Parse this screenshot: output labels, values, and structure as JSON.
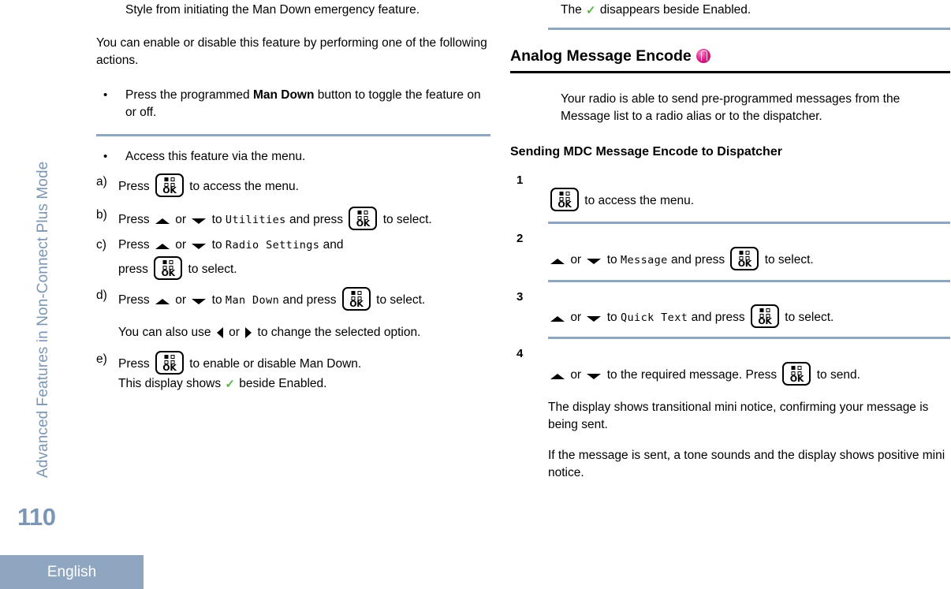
{
  "sidebar": {
    "running_head": "Advanced Features in Non-Connect Plus Mode",
    "page_number": "110",
    "language": "English",
    "accent_color": "#8fa6c0"
  },
  "icons": {
    "ok_button_label": "OK",
    "ok_button_name": "menu-ok-button-icon",
    "up_arrow": "up-arrow-icon",
    "down_arrow": "down-arrow-icon",
    "left_arrow": "left-arrow-icon",
    "right_arrow": "right-arrow-icon",
    "check_mark": "✓",
    "analog_badge": "analog-mode-badge-icon",
    "analog_badge_color": "#e0218a",
    "check_color": "#5cb544"
  },
  "left_column": {
    "continued_paragraph": "Style from initiating the Man Down emergency feature.",
    "intro_paragraph": "You can enable or disable this feature by performing one of the following actions.",
    "bullets": [
      {
        "mark": "•",
        "text_before_bold": "Press the programmed ",
        "bold": "Man Down",
        "text_after_bold": " button to toggle the feature on or off."
      },
      {
        "mark": "•",
        "text": "Access this feature via the menu."
      }
    ],
    "steps": [
      {
        "label": "a)",
        "press": "Press",
        "after_button": " to access the menu."
      },
      {
        "label": "b)",
        "press": "Press",
        "or": "or",
        "to": "to",
        "menu_item": "Utilities",
        "and_press": "and press",
        "after_button": "to select."
      },
      {
        "label": "c)",
        "press": "Press",
        "or": "or",
        "to": "to",
        "menu_item": "Radio Settings",
        "and": "and",
        "press2": "press",
        "after_button": "to select."
      },
      {
        "label": "d)",
        "press": "Press",
        "or": "or",
        "to": "to",
        "menu_item": "Man Down",
        "and_press": "and press",
        "after_button": "to select.",
        "note_before": "You can also use",
        "note_or": "or",
        "note_after": "to change the selected option."
      },
      {
        "label": "e)",
        "press": "Press",
        "after_button": " to enable or disable Man Down.",
        "result_before": "This display shows",
        "result_after": "beside Enabled."
      }
    ]
  },
  "right_column": {
    "top_note_before": "The",
    "top_note_after": "disappears beside Enabled.",
    "section_heading": "Analog Message Encode",
    "section_intro": "Your radio is able to send pre-programmed messages from the Message list to a radio alias or to the dispatcher.",
    "sub_heading": "Sending MDC Message Encode to Dispatcher",
    "numbered_steps": [
      {
        "number": "1",
        "after_button": " to access the menu."
      },
      {
        "number": "2",
        "or": "or",
        "to": "to",
        "menu_item": "Message",
        "and_press": "and press",
        "after_button": "to select."
      },
      {
        "number": "3",
        "or": "or",
        "to": "to",
        "menu_item": "Quick Text",
        "and_press": "and press",
        "after_button": "to select."
      },
      {
        "number": "4",
        "or": "or",
        "to_required": "to the required message. Press",
        "after_button": "to send.",
        "result_1": "The display shows transitional mini notice, confirming your message is being sent.",
        "result_2": "If the message is sent, a tone sounds and the display shows positive mini notice."
      }
    ]
  }
}
